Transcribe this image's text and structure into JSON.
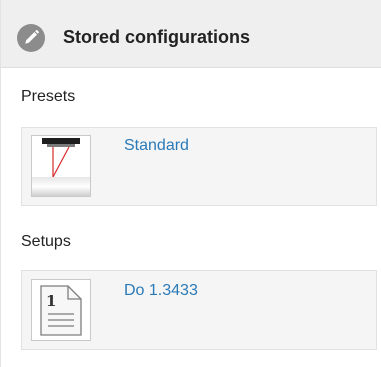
{
  "header": {
    "title": "Stored configurations",
    "icon": "pencil-icon"
  },
  "presets": {
    "label": "Presets",
    "items": [
      {
        "name": "Standard",
        "icon": "sensor-preset-icon"
      }
    ]
  },
  "setups": {
    "label": "Setups",
    "items": [
      {
        "name": "Do 1.3433",
        "icon": "document-icon"
      }
    ]
  },
  "colors": {
    "link": "#2a7ab8",
    "header_bg": "#efefef",
    "card_bg": "#f5f5f5",
    "laser_red": "#d62a2a"
  }
}
